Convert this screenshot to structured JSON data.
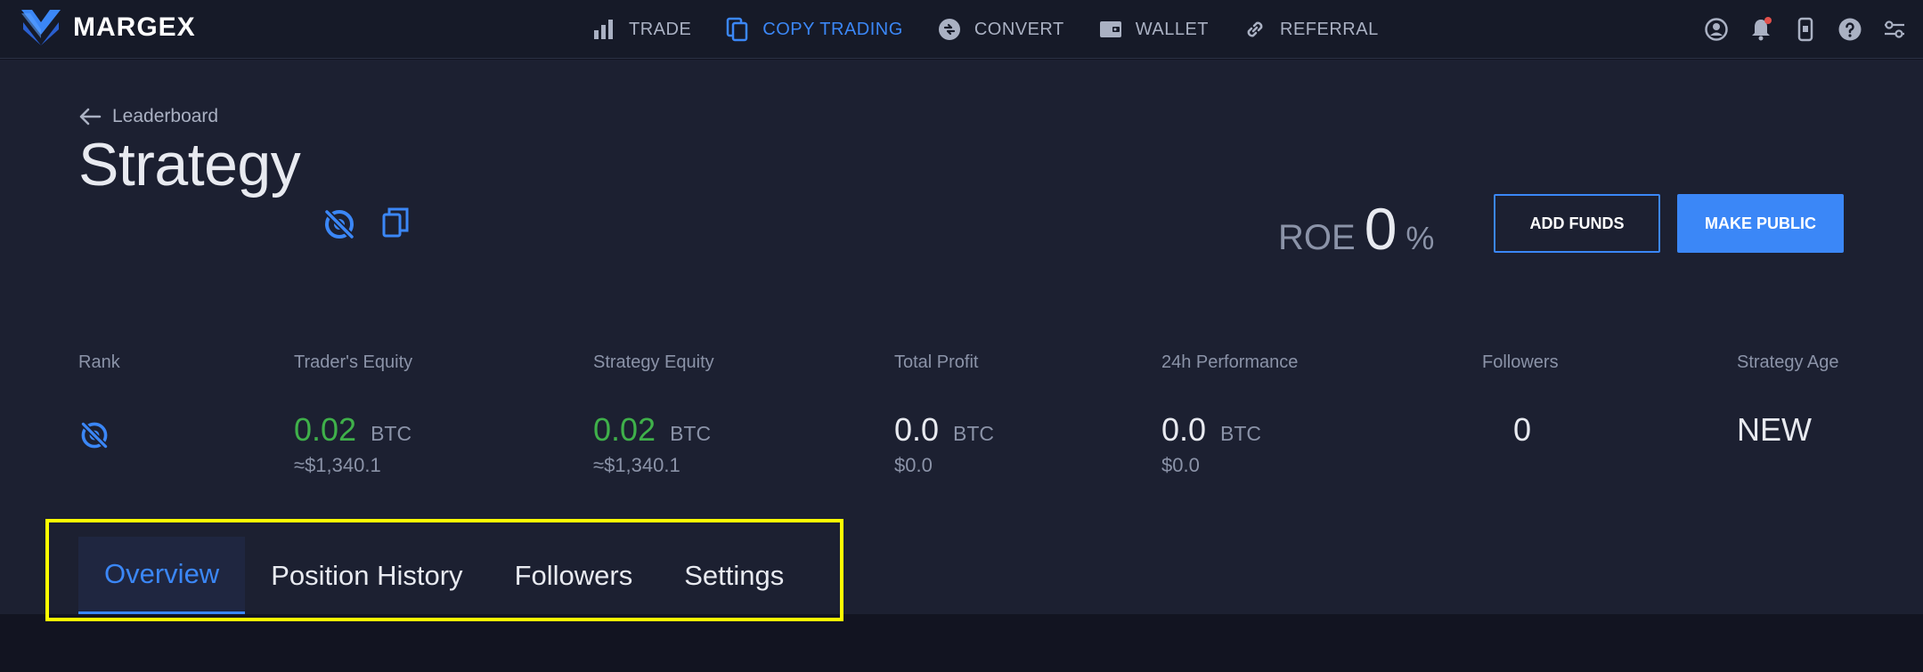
{
  "brand": {
    "name": "MARGEX",
    "accent": "#3b87f7"
  },
  "nav": {
    "items": [
      {
        "label": "TRADE",
        "icon": "bar-chart-icon",
        "active": false
      },
      {
        "label": "COPY TRADING",
        "icon": "copy-icon",
        "active": true
      },
      {
        "label": "CONVERT",
        "icon": "convert-icon",
        "active": false
      },
      {
        "label": "WALLET",
        "icon": "wallet-icon",
        "active": false
      },
      {
        "label": "REFERRAL",
        "icon": "link-icon",
        "active": false
      }
    ],
    "right_icons": [
      "user-icon",
      "bell-icon",
      "mobile-icon",
      "help-icon",
      "settings-sliders-icon"
    ]
  },
  "breadcrumb": {
    "back_label": "Leaderboard"
  },
  "header": {
    "title": "Strategy",
    "roe_label": "ROE",
    "roe_value": "0",
    "roe_unit": "%",
    "add_funds_label": "ADD FUNDS",
    "make_public_label": "MAKE PUBLIC"
  },
  "stats": {
    "rank": {
      "label": "Rank"
    },
    "traders_equity": {
      "label": "Trader's Equity",
      "value": "0.02",
      "unit": "BTC",
      "sub": "≈$1,340.1"
    },
    "strategy_equity": {
      "label": "Strategy Equity",
      "value": "0.02",
      "unit": "BTC",
      "sub": "≈$1,340.1"
    },
    "total_profit": {
      "label": "Total Profit",
      "value": "0.0",
      "unit": "BTC",
      "sub": "$0.0"
    },
    "performance_24h": {
      "label": "24h Performance",
      "value": "0.0",
      "unit": "BTC",
      "sub": "$0.0"
    },
    "followers": {
      "label": "Followers",
      "value": "0"
    },
    "strategy_age": {
      "label": "Strategy Age",
      "value": "NEW"
    }
  },
  "tabs": [
    {
      "label": "Overview",
      "active": true
    },
    {
      "label": "Position History",
      "active": false
    },
    {
      "label": "Followers",
      "active": false
    },
    {
      "label": "Settings",
      "active": false
    }
  ],
  "colors": {
    "positive": "#3fb04a",
    "highlight": "#ffff00"
  }
}
